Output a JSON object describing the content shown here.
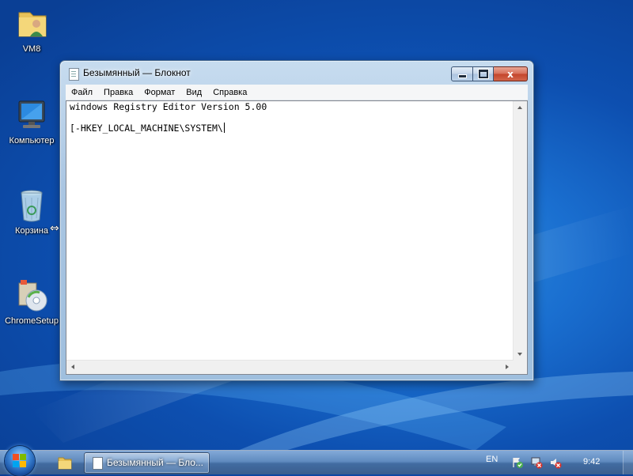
{
  "desktop": {
    "icons": [
      {
        "label": "VM8",
        "icon": "user-folder-icon"
      },
      {
        "label": "Компьютер",
        "icon": "computer-icon"
      },
      {
        "label": "Корзина",
        "icon": "recycle-bin-icon"
      },
      {
        "label": "ChromeSetup",
        "icon": "installer-icon"
      }
    ]
  },
  "window": {
    "title": "Безымянный — Блокнот",
    "controls": {
      "minimize": "minimize",
      "maximize": "maximize",
      "close": "x"
    },
    "menu": [
      "Файл",
      "Правка",
      "Формат",
      "Вид",
      "Справка"
    ],
    "content": {
      "line1": "windows Registry Editor Version 5.00",
      "line2": "[-HKEY_LOCAL_MACHINE\\SYSTEM\\"
    }
  },
  "taskbar": {
    "task_label": "Безымянный — Бло...",
    "language": "EN",
    "clock": "9:42"
  },
  "colors": {
    "desktop_blue": "#1a6fd0",
    "close_red": "#c4452c"
  }
}
